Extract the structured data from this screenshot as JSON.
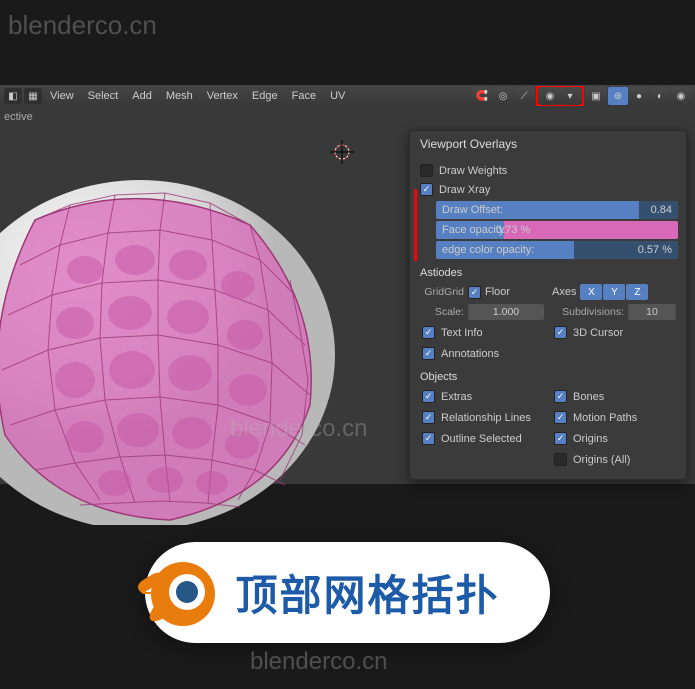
{
  "watermarks": {
    "w1": "blenderco.cn",
    "w2": "blenderco.cn",
    "w3": "blenderco.cn"
  },
  "toolbar": {
    "menus": [
      "View",
      "Select",
      "Add",
      "Mesh",
      "Vertex",
      "Edge",
      "Face",
      "UV"
    ]
  },
  "perspective": "ective",
  "panel": {
    "title": "Viewport Overlays",
    "drawWeights": "Draw Weights",
    "drawXray": "Draw Xray",
    "drawOffset": {
      "label": "Draw Offset:",
      "value": "0.84"
    },
    "faceOpacity": {
      "label": "Face opacity:",
      "value": "0.73 %"
    },
    "edgeOpacity": {
      "label": "edge color opacity:",
      "value": "0.57 %"
    },
    "section2": "Astiodes",
    "grid": "GridGrid",
    "floor": "Floor",
    "axes": "Axes",
    "axisX": "X",
    "axisY": "Y",
    "axisZ": "Z",
    "scale": {
      "label": "Scale:",
      "value": "1.000"
    },
    "subdiv": {
      "label": "Subdivisions:",
      "value": "10"
    },
    "textInfo": "Text Info",
    "cursor3d": "3D Cursor",
    "annotations": "Annotations",
    "objects": "Objects",
    "extras": "Extras",
    "bones": "Bones",
    "relLines": "Relationship Lines",
    "motionPaths": "Motion Paths",
    "outlineSel": "Outline Selected",
    "origins": "Origins",
    "originsAll": "Origins (All)"
  },
  "banner": {
    "text": "顶部网格括扑"
  }
}
